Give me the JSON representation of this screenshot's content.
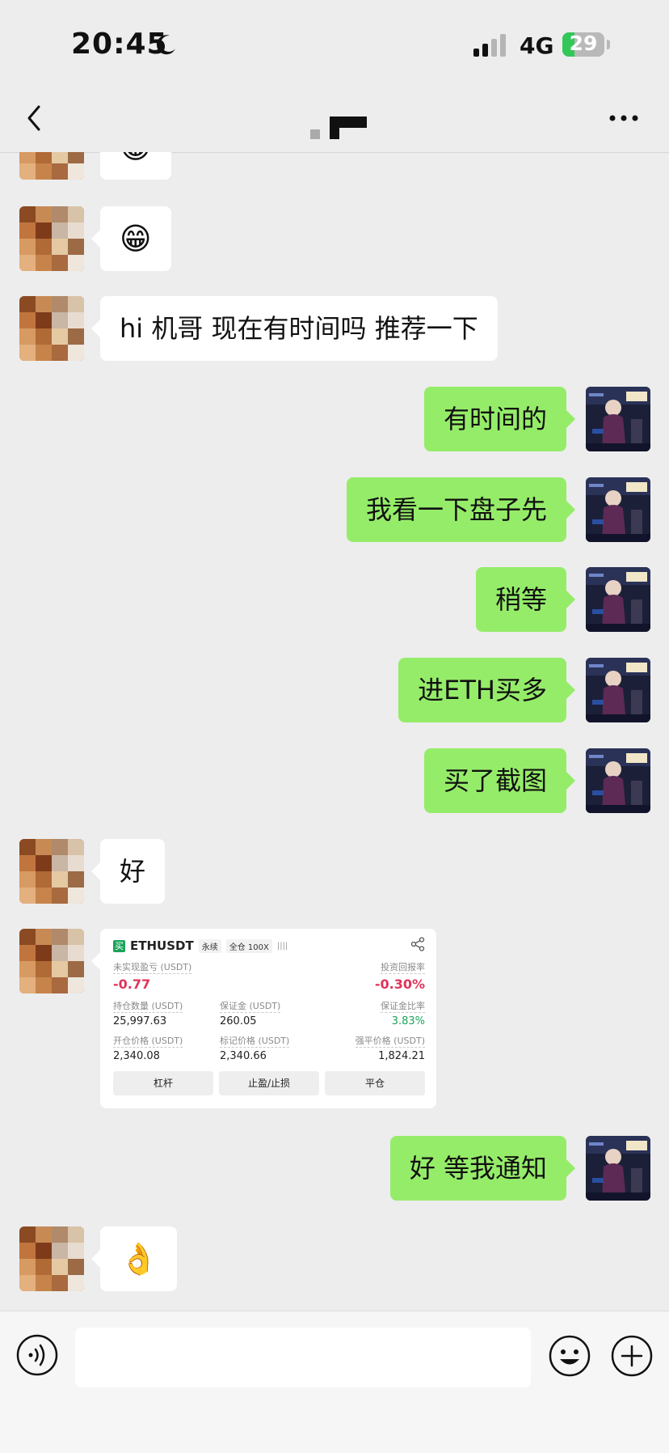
{
  "status_bar": {
    "time": "20:45",
    "network": "4G",
    "battery": "29",
    "battery_level": 0.29
  },
  "navbar": {
    "title_hidden": true
  },
  "messages": [
    {
      "side": "in",
      "text": "😁",
      "emoji": true,
      "partial": true
    },
    {
      "side": "in",
      "text": "😁",
      "emoji": true
    },
    {
      "side": "in",
      "text": "hi 机哥 现在有时间吗 推荐一下"
    },
    {
      "side": "out",
      "text": "有时间的"
    },
    {
      "side": "out",
      "text": "我看一下盘子先"
    },
    {
      "side": "out",
      "text": "稍等"
    },
    {
      "side": "out",
      "text": "进ETH买多"
    },
    {
      "side": "out",
      "text": "买了截图"
    },
    {
      "side": "in",
      "text": "好"
    },
    {
      "side": "in",
      "card": true
    },
    {
      "side": "out",
      "text": "好 等我通知"
    },
    {
      "side": "in",
      "text": "👌",
      "emoji": true
    }
  ],
  "trade_card": {
    "buy_badge": "买",
    "symbol": "ETHUSDT",
    "tag_perp": "永续",
    "tag_margin": "全仓 100X",
    "bars": "||||",
    "unrealized_pnl_label": "未实现盈亏 (USDT)",
    "unrealized_pnl_value": "-0.77",
    "roi_label": "投资回报率",
    "roi_value": "-0.30%",
    "position_qty_label": "持仓数量 (USDT)",
    "position_qty_value": "25,997.63",
    "margin_label": "保证金 (USDT)",
    "margin_value": "260.05",
    "margin_ratio_label": "保证金比率",
    "margin_ratio_value": "3.83%",
    "entry_price_label": "开仓价格 (USDT)",
    "entry_price_value": "2,340.08",
    "mark_price_label": "标记价格 (USDT)",
    "mark_price_value": "2,340.66",
    "liq_price_label": "强平价格 (USDT)",
    "liq_price_value": "1,824.21",
    "btn_leverage": "杠杆",
    "btn_tpsl": "止盈/止损",
    "btn_close": "平仓"
  },
  "colors": {
    "outgoing_bubble": "#95ec69",
    "incoming_bubble": "#ffffff",
    "background": "#ededed",
    "loss_red": "#e0345a",
    "ok_green": "#1aa35a"
  },
  "icons": {
    "back": "chevron-left-icon",
    "more": "more-dots-icon",
    "voice": "voice-icon",
    "emoji": "smile-icon",
    "plus": "plus-icon",
    "share": "share-icon",
    "moon": "moon-icon"
  }
}
